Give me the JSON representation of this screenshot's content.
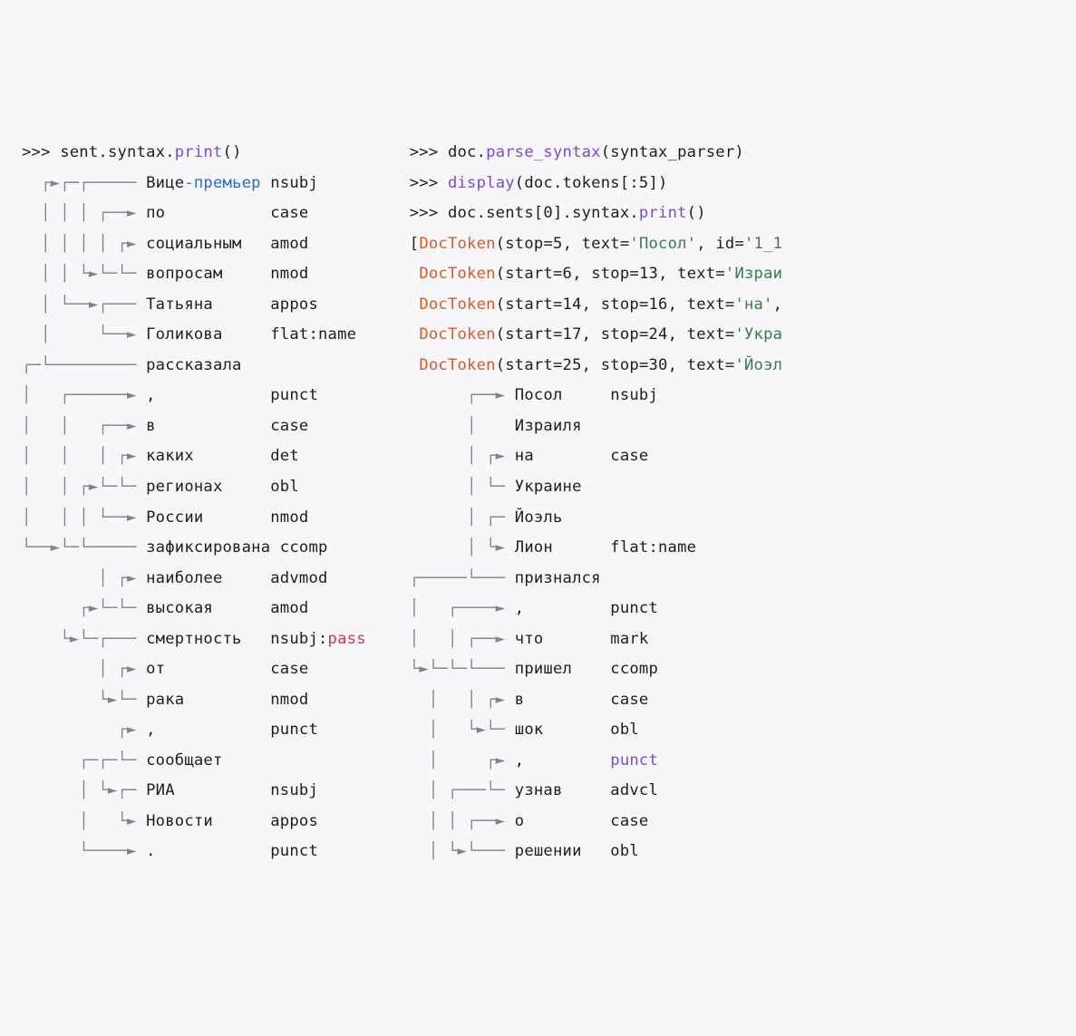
{
  "left": {
    "prompt": ">>> ",
    "call_prefix": "sent.syntax.",
    "call_name": "print",
    "call_suffix": "()",
    "rows": [
      {
        "tree": "  ┌►┌─┌───── ",
        "word": "Вице-премьер ",
        "rel": "nsubj"
      },
      {
        "tree": "  │ │ │ ┌──► ",
        "word": "по           ",
        "rel": "case"
      },
      {
        "tree": "  │ │ │ │ ┌► ",
        "word": "социальным   ",
        "rel": "amod"
      },
      {
        "tree": "  │ │ └►└─└─ ",
        "word": "вопросам     ",
        "rel": "nmod"
      },
      {
        "tree": "  │ └──►┌─── ",
        "word": "Татьяна      ",
        "rel": "appos"
      },
      {
        "tree": "  │     └──► ",
        "word": "Голикова     ",
        "rel": "flat:name"
      },
      {
        "tree": "┌─└───────── ",
        "word": "рассказала",
        "rel": ""
      },
      {
        "tree": "│   ┌──────► ",
        "word": ",            ",
        "rel": "punct"
      },
      {
        "tree": "│   │   ┌──► ",
        "word": "в            ",
        "rel": "case"
      },
      {
        "tree": "│   │   │ ┌► ",
        "word": "каких        ",
        "rel": "det"
      },
      {
        "tree": "│   │ ┌►└─└─ ",
        "word": "регионах     ",
        "rel": "obl"
      },
      {
        "tree": "│   │ │ └──► ",
        "word": "России       ",
        "rel": "nmod"
      },
      {
        "tree": "└──►└─└───── ",
        "word": "зафиксирована",
        "rel": " ccomp"
      },
      {
        "tree": "        │ ┌► ",
        "word": "наиболее     ",
        "rel": "advmod"
      },
      {
        "tree": "      ┌►└─└─ ",
        "word": "высокая      ",
        "rel": "amod"
      },
      {
        "tree": "    └►└─┌─── ",
        "word": "смертность   ",
        "rel": "nsubj:",
        "rel2": "pass"
      },
      {
        "tree": "        │ ┌► ",
        "word": "от           ",
        "rel": "case"
      },
      {
        "tree": "        └►└─ ",
        "word": "рака         ",
        "rel": "nmod"
      },
      {
        "tree": "          ┌► ",
        "word": ",            ",
        "rel": "punct"
      },
      {
        "tree": "      ┌─┌─└─ ",
        "word": "сообщает",
        "rel": ""
      },
      {
        "tree": "      │ └►┌─ ",
        "word": "РИА          ",
        "rel": "nsubj"
      },
      {
        "tree": "      │   └► ",
        "word": "Новости      ",
        "rel": "appos"
      },
      {
        "tree": "      └────► ",
        "word": ".            ",
        "rel": "punct"
      }
    ]
  },
  "right": {
    "line1_prefix": ">>> doc.",
    "line1_call": "parse_syntax",
    "line1_suffix": "(syntax_parser)",
    "line2_prompt": ">>> ",
    "line2_call": "display",
    "line2_mid": "(doc.tokens[:",
    "line2_num": "5",
    "line2_end": "])",
    "line3_prefix": ">>> doc.sents[",
    "line3_num": "0",
    "line3_mid": "].syntax.",
    "line3_call": "print",
    "line3_suffix": "()",
    "tok1_a": "[",
    "tok1_b": "DocToken",
    "tok1_c": "(stop=",
    "tok1_d": "5",
    "tok1_e": ", text=",
    "tok1_f": "'Посол'",
    "tok1_g": ", id=",
    "tok1_h": "'1_1",
    "tok2_a": " ",
    "tok2_b": "DocToken",
    "tok2_c": "(start=",
    "tok2_d": "6",
    "tok2_e": ", stop=",
    "tok2_f": "13",
    "tok2_g": ", text=",
    "tok2_h": "'Израи",
    "tok3_a": " ",
    "tok3_b": "DocToken",
    "tok3_c": "(start=",
    "tok3_d": "14",
    "tok3_e": ", stop=",
    "tok3_f": "16",
    "tok3_g": ", text=",
    "tok3_h": "'на'",
    "tok3_i": ",",
    "tok4_a": " ",
    "tok4_b": "DocToken",
    "tok4_c": "(start=",
    "tok4_d": "17",
    "tok4_e": ", stop=",
    "tok4_f": "24",
    "tok4_g": ", text=",
    "tok4_h": "'Укра",
    "tok5_a": " ",
    "tok5_b": "DocToken",
    "tok5_c": "(start=",
    "tok5_d": "25",
    "tok5_e": ", stop=",
    "tok5_f": "30",
    "tok5_g": ", text=",
    "tok5_h": "'Йоэл",
    "rows": [
      {
        "tree": "      ┌──► ",
        "word": "Посол     ",
        "rel": "nsubj"
      },
      {
        "tree": "      │    ",
        "word": "Израиля",
        "rel": ""
      },
      {
        "tree": "      │ ┌► ",
        "word": "на        ",
        "rel": "case"
      },
      {
        "tree": "      │ └─ ",
        "word": "Украине",
        "rel": ""
      },
      {
        "tree": "      │ ┌─ ",
        "word": "Йоэль",
        "rel": ""
      },
      {
        "tree": "      │ └► ",
        "word": "Лион      ",
        "rel": "flat:name"
      },
      {
        "tree": "┌─────└─── ",
        "word": "признался",
        "rel": ""
      },
      {
        "tree": "│   ┌────► ",
        "word": ",         ",
        "rel": "punct"
      },
      {
        "tree": "│   │ ┌──► ",
        "word": "что       ",
        "rel": "mark"
      },
      {
        "tree": "└►└─└─└─── ",
        "word": "пришел    ",
        "rel": "ccomp"
      },
      {
        "tree": "  │   │ ┌► ",
        "word": "в         ",
        "rel": "case"
      },
      {
        "tree": "  │   └►└─ ",
        "word": "шок       ",
        "rel": "obl"
      },
      {
        "tree": "  │     ┌► ",
        "word": ",         ",
        "rel": "punct",
        "relclass": "purple"
      },
      {
        "tree": "  │ ┌───└─ ",
        "word": "узнав     ",
        "rel": "advcl"
      },
      {
        "tree": "  │ │ ┌──► ",
        "word": "о         ",
        "rel": "case"
      },
      {
        "tree": "  │ └►└─── ",
        "word": "решении   ",
        "rel": "obl"
      }
    ]
  }
}
